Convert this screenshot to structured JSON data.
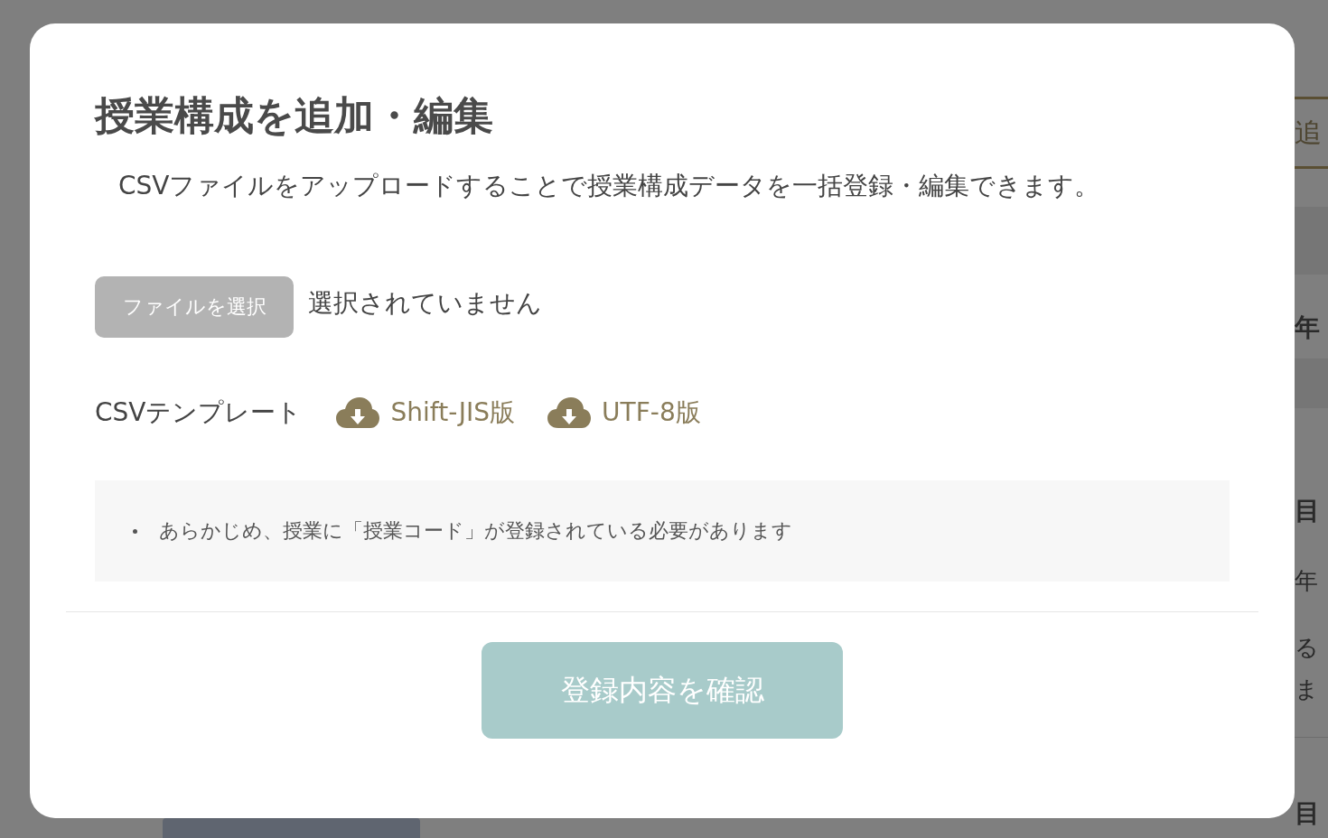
{
  "background_page": {
    "fragments": [
      {
        "kind": "tab",
        "text": "追"
      },
      {
        "kind": "band"
      },
      {
        "kind": "heading",
        "text": "年"
      },
      {
        "kind": "band"
      },
      {
        "kind": "heading",
        "text": "目"
      },
      {
        "kind": "text",
        "text": "年"
      },
      {
        "kind": "text",
        "text": "る"
      },
      {
        "kind": "text",
        "text": "ま"
      },
      {
        "kind": "rule"
      },
      {
        "kind": "heading",
        "text": "目"
      }
    ]
  },
  "dialog": {
    "title": "授業構成を追加・編集",
    "description": "CSVファイルをアップロードすることで授業構成データを一括登録・編集できます。",
    "file_input": {
      "button": "ファイルを選択",
      "status": "選択されていません"
    },
    "template": {
      "label": "CSVテンプレート",
      "links": [
        {
          "label": "Shift-JIS版"
        },
        {
          "label": "UTF-8版"
        }
      ]
    },
    "notes": [
      "あらかじめ、授業に「授業コード」が登録されている必要があります"
    ],
    "submit": {
      "label": "登録内容を確認",
      "disabled": true
    }
  }
}
